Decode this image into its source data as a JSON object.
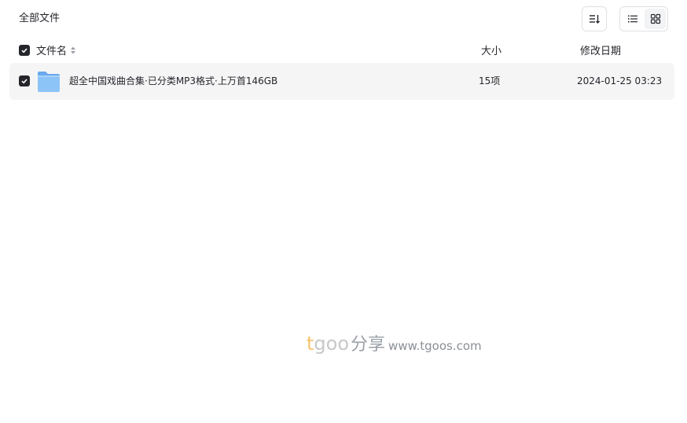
{
  "breadcrumb": {
    "title": "全部文件"
  },
  "toolbar": {
    "sort_icon": "sort-icon",
    "list_view_icon": "list-view-icon",
    "grid_view_icon": "grid-view-icon"
  },
  "table": {
    "columns": {
      "name": "文件名",
      "size": "大小",
      "modified": "修改日期"
    },
    "header_checked": true,
    "rows": [
      {
        "checked": true,
        "type_icon": "folder-icon",
        "name": "超全中国戏曲合集·已分类MP3格式·上万首146GB",
        "size": "15项",
        "modified": "2024-01-25 03:23"
      }
    ]
  },
  "watermark": {
    "brand_t": "t",
    "brand_goo": "goo",
    "brand_cn": "分享",
    "url": "www.tgoos.com"
  },
  "colors": {
    "row_selected_bg": "#f5f5f6",
    "checkbox": "#25262b",
    "folder": "#7ab8f5",
    "border": "#dfe0e4"
  }
}
